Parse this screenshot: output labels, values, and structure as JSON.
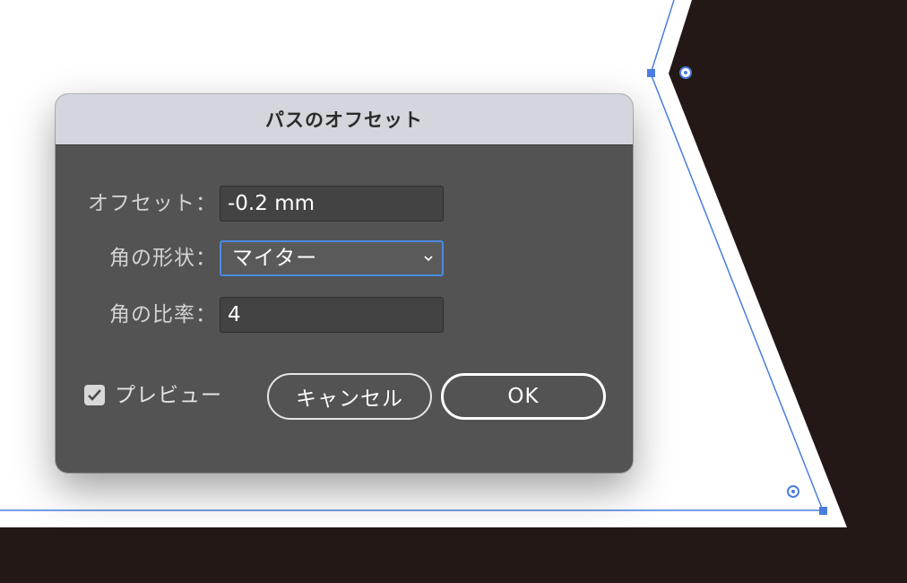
{
  "colors": {
    "artwork_fill": "#231815",
    "selection_blue": "#4a7de0",
    "dialog_bg": "#535353",
    "titlebar_bg": "#d3d6dc",
    "focus_ring": "#4b8ae2"
  },
  "dialog": {
    "title": "パスのオフセット",
    "offset": {
      "label": "オフセット：",
      "value": "-0.2 mm"
    },
    "joins": {
      "label": "角の形状：",
      "value": "マイター",
      "icon": "chevron-down-icon"
    },
    "miter_limit": {
      "label": "角の比率：",
      "value": "4"
    },
    "preview": {
      "label": "プレビュー",
      "checked": true,
      "icon": "checkmark-icon"
    },
    "cancel_label": "キャンセル",
    "ok_label": "OK"
  }
}
